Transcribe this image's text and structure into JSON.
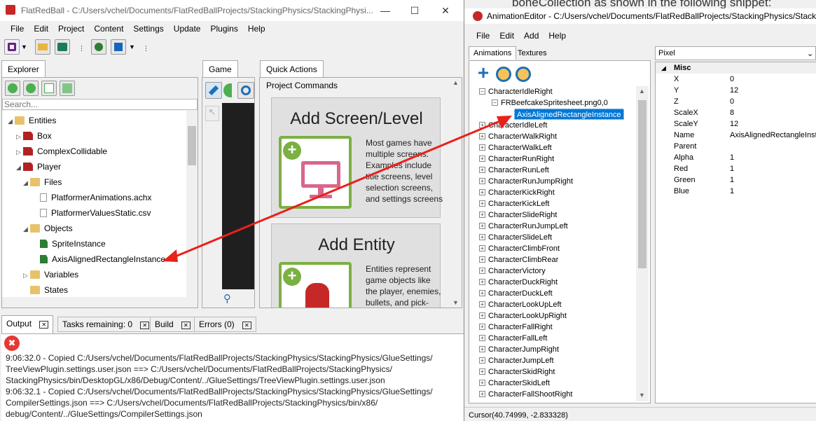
{
  "bg_text": "boneCollection as shown in the following snippet:",
  "glue": {
    "title": "FlatRedBall - C:/Users/vchel/Documents/FlatRedBallProjects/StackingPhysics/StackingPhysi...",
    "menu": [
      "File",
      "Edit",
      "Project",
      "Content",
      "Settings",
      "Update",
      "Plugins",
      "Help"
    ],
    "explorer_tab": "Explorer",
    "search_placeholder": "Search...",
    "tree": {
      "entities": "Entities",
      "box": "Box",
      "complex": "ComplexCollidable",
      "player": "Player",
      "files": "Files",
      "achx": "PlatformerAnimations.achx",
      "csv": "PlatformerValuesStatic.csv",
      "objects": "Objects",
      "sprite": "SpriteInstance",
      "aabb": "AxisAlignedRectangleInstance",
      "variables": "Variables",
      "states": "States"
    },
    "game_tab": "Game",
    "quick_actions_tab": "Quick Actions",
    "project_commands": "Project Commands",
    "add_screen": {
      "title": "Add Screen/Level",
      "desc": [
        "Most games have",
        "multiple screens.",
        "Examples include",
        "title screens, level",
        "selection screens,",
        "and settings screens"
      ]
    },
    "add_entity": {
      "title": "Add Entity",
      "desc": [
        "Entities represent",
        "game objects like",
        "the player, enemies,",
        "bullets, and pick-"
      ]
    },
    "bottom_tabs": {
      "output": "Output",
      "tasks": "Tasks remaining: 0",
      "build": "Build",
      "errors": "Errors (0)"
    },
    "output_lines": [
      "9:06:32.0 - Copied C:/Users/vchel/Documents/FlatRedBallProjects/StackingPhysics/StackingPhysics/GlueSettings/",
      "TreeViewPlugin.settings.user.json ==> C:/Users/vchel/Documents/FlatRedBallProjects/StackingPhysics/",
      "StackingPhysics/bin/DesktopGL/x86/Debug/Content/../GlueSettings/TreeViewPlugin.settings.user.json",
      "9:06:32.1 - Copied C:/Users/vchel/Documents/FlatRedBallProjects/StackingPhysics/StackingPhysics/GlueSettings/",
      "CompilerSettings.json ==> C:/Users/vchel/Documents/FlatRedBallProjects/StackingPhysics/bin/x86/",
      "debug/Content/../GlueSettings/CompilerSettings.json"
    ]
  },
  "anim": {
    "title": "AnimationEditor - C:/Users/vchel/Documents/FlatRedBallProjects/StackingPhysics/Stacki",
    "menu": [
      "File",
      "Edit",
      "Add",
      "Help"
    ],
    "tabs": [
      "Animations",
      "Textures"
    ],
    "unit": "Pixel",
    "chains": {
      "idle_right": "CharacterIdleRight",
      "frame": "FRBeefcakeSpritesheet.png0,0",
      "selected": "AxisAlignedRectangleInstance"
    },
    "chain_list": [
      "CharacterIdleLeft",
      "CharacterWalkRight",
      "CharacterWalkLeft",
      "CharacterRunRight",
      "CharacterRunLeft",
      "CharacterRunJumpRight",
      "CharacterKickRight",
      "CharacterKickLeft",
      "CharacterSlideRight",
      "CharacterRunJumpLeft",
      "CharacterSlideLeft",
      "CharacterClimbFront",
      "CharacterClimbRear",
      "CharacterVictory",
      "CharacterDuckRight",
      "CharacterDuckLeft",
      "CharacterLookUpLeft",
      "CharacterLookUpRight",
      "CharacterFallRight",
      "CharacterFallLeft",
      "CharacterJumpRight",
      "CharacterJumpLeft",
      "CharacterSkidRight",
      "CharacterSkidLeft",
      "CharacterFallShootRight"
    ],
    "props_header": "Misc",
    "props": [
      {
        "k": "X",
        "v": "0"
      },
      {
        "k": "Y",
        "v": "12"
      },
      {
        "k": "Z",
        "v": "0"
      },
      {
        "k": "ScaleX",
        "v": "8"
      },
      {
        "k": "ScaleY",
        "v": "12"
      },
      {
        "k": "Name",
        "v": "AxisAlignedRectangleInsta"
      },
      {
        "k": "Parent",
        "v": ""
      },
      {
        "k": "Alpha",
        "v": "1"
      },
      {
        "k": "Red",
        "v": "1"
      },
      {
        "k": "Green",
        "v": "1"
      },
      {
        "k": "Blue",
        "v": "1"
      }
    ],
    "status": "Cursor(40.74999, -2.833328)"
  },
  "colors": {
    "arrow": "#e8211b",
    "selection": "#0078d7",
    "qa_green": "#7bb043"
  }
}
